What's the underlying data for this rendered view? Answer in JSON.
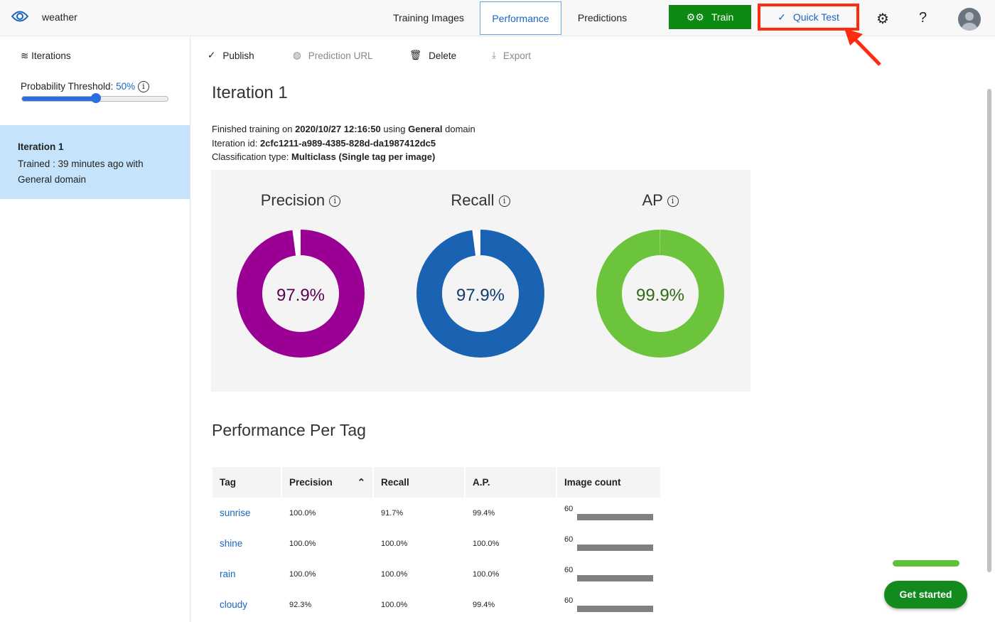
{
  "header": {
    "project": "weather",
    "tabs": [
      "Training Images",
      "Performance",
      "Predictions"
    ],
    "active_tab": "Performance",
    "train_label": "Train",
    "quick_test_label": "Quick Test",
    "help": "?"
  },
  "sidebar": {
    "iterations_label": "Iterations",
    "threshold_label": "Probability Threshold:",
    "threshold_value": "50%",
    "threshold_fraction": 0.5,
    "iteration": {
      "name": "Iteration 1",
      "line1": "Trained : 39 minutes ago with",
      "line2": "General domain"
    }
  },
  "toolbar": {
    "publish": "Publish",
    "prediction_url": "Prediction URL",
    "delete": "Delete",
    "export": "Export"
  },
  "main": {
    "title": "Iteration 1",
    "info": {
      "l1a": "Finished training on ",
      "l1b": "2020/10/27 12:16:50",
      "l1c": " using ",
      "l1d": "General",
      "l1e": " domain",
      "l2a": "Iteration id: ",
      "l2b": "2cfc1211-a989-4385-828d-da1987412dc5",
      "l3a": "Classification type: ",
      "l3b": "Multiclass (Single tag per image)"
    },
    "metrics": [
      {
        "label": "Precision",
        "value": "97.9%",
        "fraction": 0.979,
        "color": "#9b0094",
        "text_color": "#5a0056"
      },
      {
        "label": "Recall",
        "value": "97.9%",
        "fraction": 0.979,
        "color": "#1a63b2",
        "text_color": "#0f3a6e"
      },
      {
        "label": "AP",
        "value": "99.9%",
        "fraction": 0.999,
        "color": "#6bc43b",
        "text_color": "#2f6a12"
      }
    ],
    "per_tag_title": "Performance Per Tag",
    "table": {
      "headers": [
        "Tag",
        "Precision",
        "Recall",
        "A.P.",
        "Image count"
      ],
      "rows": [
        [
          "sunrise",
          "100.0%",
          "91.7%",
          "99.4%",
          "60"
        ],
        [
          "shine",
          "100.0%",
          "100.0%",
          "100.0%",
          "60"
        ],
        [
          "rain",
          "100.0%",
          "100.0%",
          "100.0%",
          "60"
        ],
        [
          "cloudy",
          "92.3%",
          "100.0%",
          "99.4%",
          "60"
        ]
      ]
    }
  },
  "get_started": "Get started"
}
